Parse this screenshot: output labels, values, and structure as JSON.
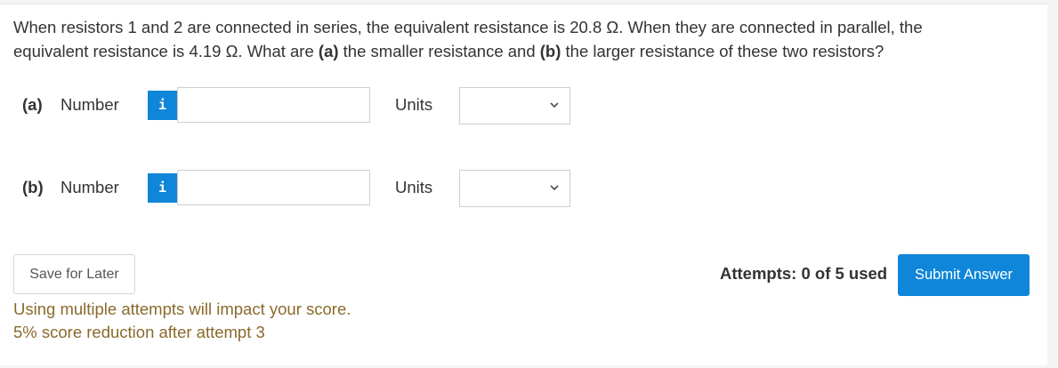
{
  "question": {
    "text_1": "When resistors 1 and 2 are connected in series, the equivalent resistance is 20.8 Ω. When they are connected in parallel, the equivalent resistance is 4.19 Ω. What are ",
    "part_a_ref": "(a)",
    "text_2": " the smaller resistance and ",
    "part_b_ref": "(b)",
    "text_3": " the larger resistance of these two resistors?"
  },
  "parts": [
    {
      "label": "(a)",
      "number_label": "Number",
      "info_icon": "i",
      "value": "",
      "units_label": "Units",
      "units_selected": ""
    },
    {
      "label": "(b)",
      "number_label": "Number",
      "info_icon": "i",
      "value": "",
      "units_label": "Units",
      "units_selected": ""
    }
  ],
  "footer": {
    "save_label": "Save for Later",
    "attempts_text": "Attempts: 0 of 5 used",
    "submit_label": "Submit Answer",
    "notice_line1": "Using multiple attempts will impact your score.",
    "notice_line2": "5% score reduction after attempt 3"
  },
  "colors": {
    "accent": "#0f86d9",
    "notice": "#8a6a2b"
  },
  "icons": {
    "info": "info-icon",
    "dropdown": "chevron-down-icon"
  }
}
